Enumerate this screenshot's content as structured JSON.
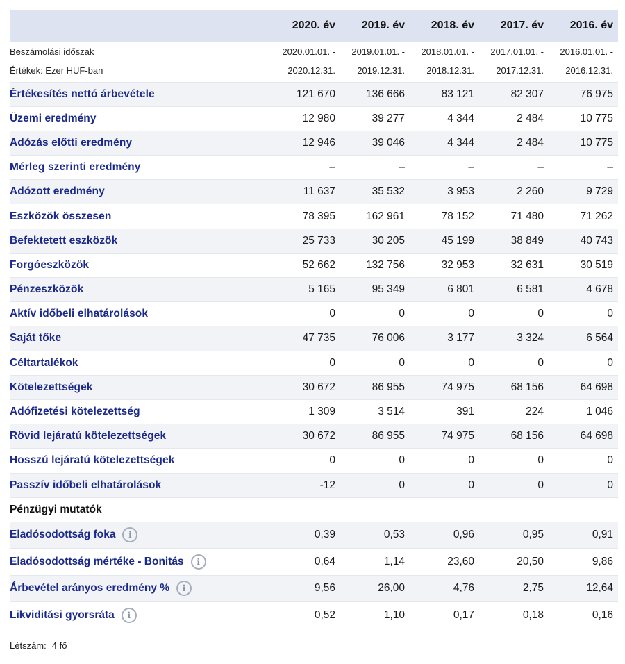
{
  "years": [
    "2020. év",
    "2019. év",
    "2018. év",
    "2017. év",
    "2016. év"
  ],
  "period": {
    "label1": "Beszámolási időszak",
    "label2": "Értékek: Ezer HUF-ban",
    "starts": [
      "2020.01.01. -",
      "2019.01.01. -",
      "2018.01.01. -",
      "2017.01.01. -",
      "2016.01.01. -"
    ],
    "ends": [
      "2020.12.31.",
      "2019.12.31.",
      "2018.12.31.",
      "2017.12.31.",
      "2016.12.31."
    ]
  },
  "rows": [
    {
      "label": "Értékesítés nettó árbevétele",
      "values": [
        "121 670",
        "136 666",
        "83 121",
        "82 307",
        "76 975"
      ]
    },
    {
      "label": "Üzemi eredmény",
      "values": [
        "12 980",
        "39 277",
        "4 344",
        "2 484",
        "10 775"
      ]
    },
    {
      "label": "Adózás előtti eredmény",
      "values": [
        "12 946",
        "39 046",
        "4 344",
        "2 484",
        "10 775"
      ]
    },
    {
      "label": "Mérleg szerinti eredmény",
      "values": [
        "–",
        "–",
        "–",
        "–",
        "–"
      ]
    },
    {
      "label": "Adózott eredmény",
      "values": [
        "11 637",
        "35 532",
        "3 953",
        "2 260",
        "9 729"
      ]
    },
    {
      "label": "Eszközök összesen",
      "values": [
        "78 395",
        "162 961",
        "78 152",
        "71 480",
        "71 262"
      ]
    },
    {
      "label": "Befektetett eszközök",
      "values": [
        "25 733",
        "30 205",
        "45 199",
        "38 849",
        "40 743"
      ]
    },
    {
      "label": "Forgóeszközök",
      "values": [
        "52 662",
        "132 756",
        "32 953",
        "32 631",
        "30 519"
      ]
    },
    {
      "label": "Pénzeszközök",
      "values": [
        "5 165",
        "95 349",
        "6 801",
        "6 581",
        "4 678"
      ]
    },
    {
      "label": "Aktív időbeli elhatárolások",
      "values": [
        "0",
        "0",
        "0",
        "0",
        "0"
      ]
    },
    {
      "label": "Saját tőke",
      "values": [
        "47 735",
        "76 006",
        "3 177",
        "3 324",
        "6 564"
      ]
    },
    {
      "label": "Céltartalékok",
      "values": [
        "0",
        "0",
        "0",
        "0",
        "0"
      ]
    },
    {
      "label": "Kötelezettségek",
      "values": [
        "30 672",
        "86 955",
        "74 975",
        "68 156",
        "64 698"
      ]
    },
    {
      "label": "Adófizetési kötelezettség",
      "values": [
        "1 309",
        "3 514",
        "391",
        "224",
        "1 046"
      ]
    },
    {
      "label": "Rövid lejáratú kötelezettségek",
      "values": [
        "30 672",
        "86 955",
        "74 975",
        "68 156",
        "64 698"
      ]
    },
    {
      "label": "Hosszú lejáratú kötelezettségek",
      "values": [
        "0",
        "0",
        "0",
        "0",
        "0"
      ]
    },
    {
      "label": "Passzív időbeli elhatárolások",
      "values": [
        "-12",
        "0",
        "0",
        "0",
        "0"
      ]
    }
  ],
  "ratios_title": "Pénzügyi mutatók",
  "info_icon": "info-circle-icon",
  "info_glyph": "i",
  "ratios": [
    {
      "label": "Eladósodottság foka",
      "values": [
        "0,39",
        "0,53",
        "0,96",
        "0,95",
        "0,91"
      ]
    },
    {
      "label": "Eladósodottság mértéke - Bonitás",
      "values": [
        "0,64",
        "1,14",
        "23,60",
        "20,50",
        "9,86"
      ]
    },
    {
      "label": "Árbevétel arányos eredmény %",
      "values": [
        "9,56",
        "26,00",
        "4,76",
        "2,75",
        "12,64"
      ]
    },
    {
      "label": "Likviditási gyorsráta",
      "values": [
        "0,52",
        "1,10",
        "0,17",
        "0,18",
        "0,16"
      ]
    }
  ],
  "staff": {
    "label": "Létszám:",
    "value": "4 fő"
  },
  "colors": {
    "label_blue": "#1b2a8a",
    "header_bg": "#dde3f1",
    "alt_row_bg": "#f1f3f7"
  }
}
